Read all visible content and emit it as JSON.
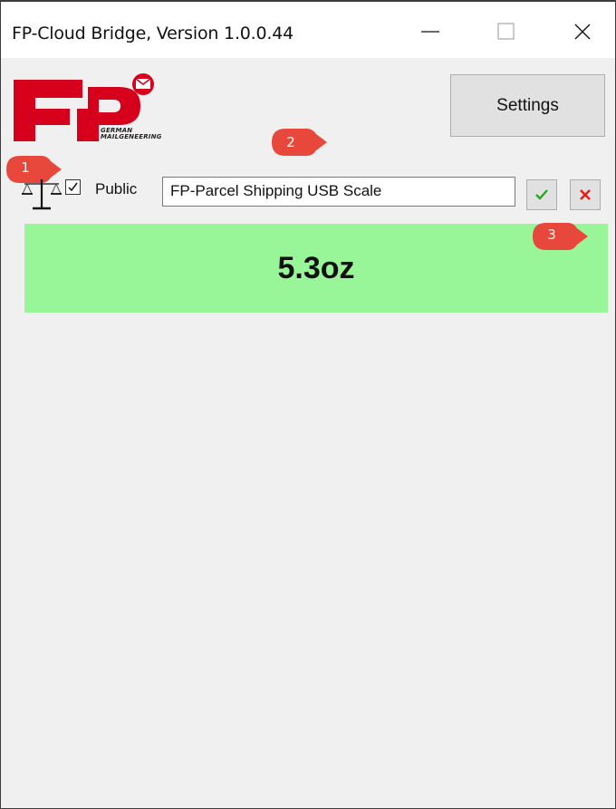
{
  "window": {
    "title": "FP-Cloud Bridge, Version 1.0.0.44"
  },
  "logo": {
    "brand": "FP",
    "subtitle_line1": "GERMAN",
    "subtitle_line2": "MAILGENEERING",
    "color": "#d6001c"
  },
  "toolbar": {
    "settings_label": "Settings"
  },
  "callouts": [
    "1",
    "2",
    "3"
  ],
  "scale": {
    "icon": "scale-icon",
    "public_label": "Public",
    "public_checked": true,
    "name_value": "FP-Parcel Shipping USB Scale",
    "confirm_icon": "checkmark-icon",
    "cancel_icon": "x-icon",
    "weight": "5.3oz",
    "weight_bg": "#98f598"
  },
  "colors": {
    "callout": "#e8473c",
    "confirm": "#2aa52a",
    "cancel": "#e0201c"
  }
}
